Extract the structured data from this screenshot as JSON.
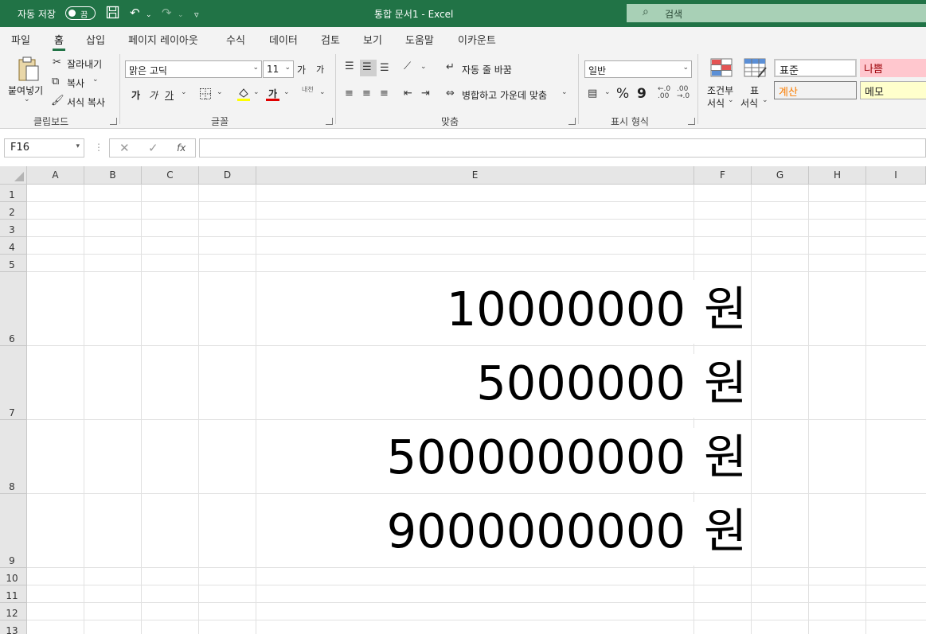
{
  "titlebar": {
    "autosave_label": "자동 저장",
    "autosave_state": "끔",
    "doc_title": "통합 문서1  -  Excel",
    "search_placeholder": "검색"
  },
  "tabs": [
    "파일",
    "홈",
    "삽입",
    "페이지 레이아웃",
    "수식",
    "데이터",
    "검토",
    "보기",
    "도움말",
    "이카운트"
  ],
  "active_tab": "홈",
  "ribbon": {
    "clipboard": {
      "paste": "붙여넣기",
      "cut": "잘라내기",
      "copy": "복사",
      "format_painter": "서식 복사",
      "group_label": "클립보드"
    },
    "font": {
      "font_name": "맑은 고딕",
      "font_size": "11",
      "grow": "가",
      "shrink": "가",
      "bold": "가",
      "italic": "가",
      "underline": "가",
      "font_color_glyph": "가",
      "phonetic": "내천",
      "group_label": "글꼴"
    },
    "alignment": {
      "wrap_text": "자동 줄 바꿈",
      "merge_center": "병합하고 가운데 맞춤",
      "group_label": "맞춤"
    },
    "number": {
      "format": "일반",
      "percent": "%",
      "comma": "9",
      "group_label": "표시 형식"
    },
    "styles": {
      "conditional": [
        "조건부",
        "서식"
      ],
      "table": [
        "표",
        "서식"
      ],
      "normal": "표준",
      "bad": "나쁨",
      "calculation": "계산",
      "note": "메모"
    }
  },
  "formula_bar": {
    "name_box": "F16",
    "cancel": "✕",
    "enter": "✓",
    "fx": "fx",
    "content": ""
  },
  "sheet": {
    "columns": [
      "A",
      "B",
      "C",
      "D",
      "E",
      "F",
      "G",
      "H",
      "I"
    ],
    "rows": [
      "1",
      "2",
      "3",
      "4",
      "5",
      "6",
      "7",
      "8",
      "9",
      "10",
      "11",
      "12",
      "13"
    ],
    "cells": [
      {
        "ref": "E6",
        "value": "10000000",
        "unit": "원"
      },
      {
        "ref": "E7",
        "value": "5000000",
        "unit": "원"
      },
      {
        "ref": "E8",
        "value": "5000000000",
        "unit": "원"
      },
      {
        "ref": "E9",
        "value": "9000000000",
        "unit": "원"
      }
    ]
  },
  "colors": {
    "brand": "#217346",
    "bad_fill": "#ffc7ce",
    "bad_text": "#9c0006",
    "calc_text": "#fa7d00",
    "note_fill": "#ffffcc",
    "font_color_bar": "#e00000",
    "highlight_bar": "#ffff00"
  }
}
